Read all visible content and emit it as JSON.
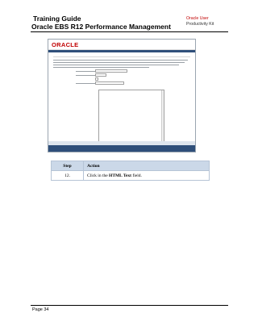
{
  "header": {
    "title": "Training Guide",
    "subtitle": "Oracle EBS R12 Performance Management",
    "brand_line1": "Oracle User",
    "brand_line2": "Productivity Kit"
  },
  "screenshot": {
    "logo": "ORACLE"
  },
  "table": {
    "col_step": "Step",
    "col_action": "Action",
    "rows": [
      {
        "step": "12.",
        "action_pre": "Click in the ",
        "action_bold": "HTML Text",
        "action_post": " field."
      }
    ]
  },
  "footer": {
    "page": "Page 34"
  }
}
